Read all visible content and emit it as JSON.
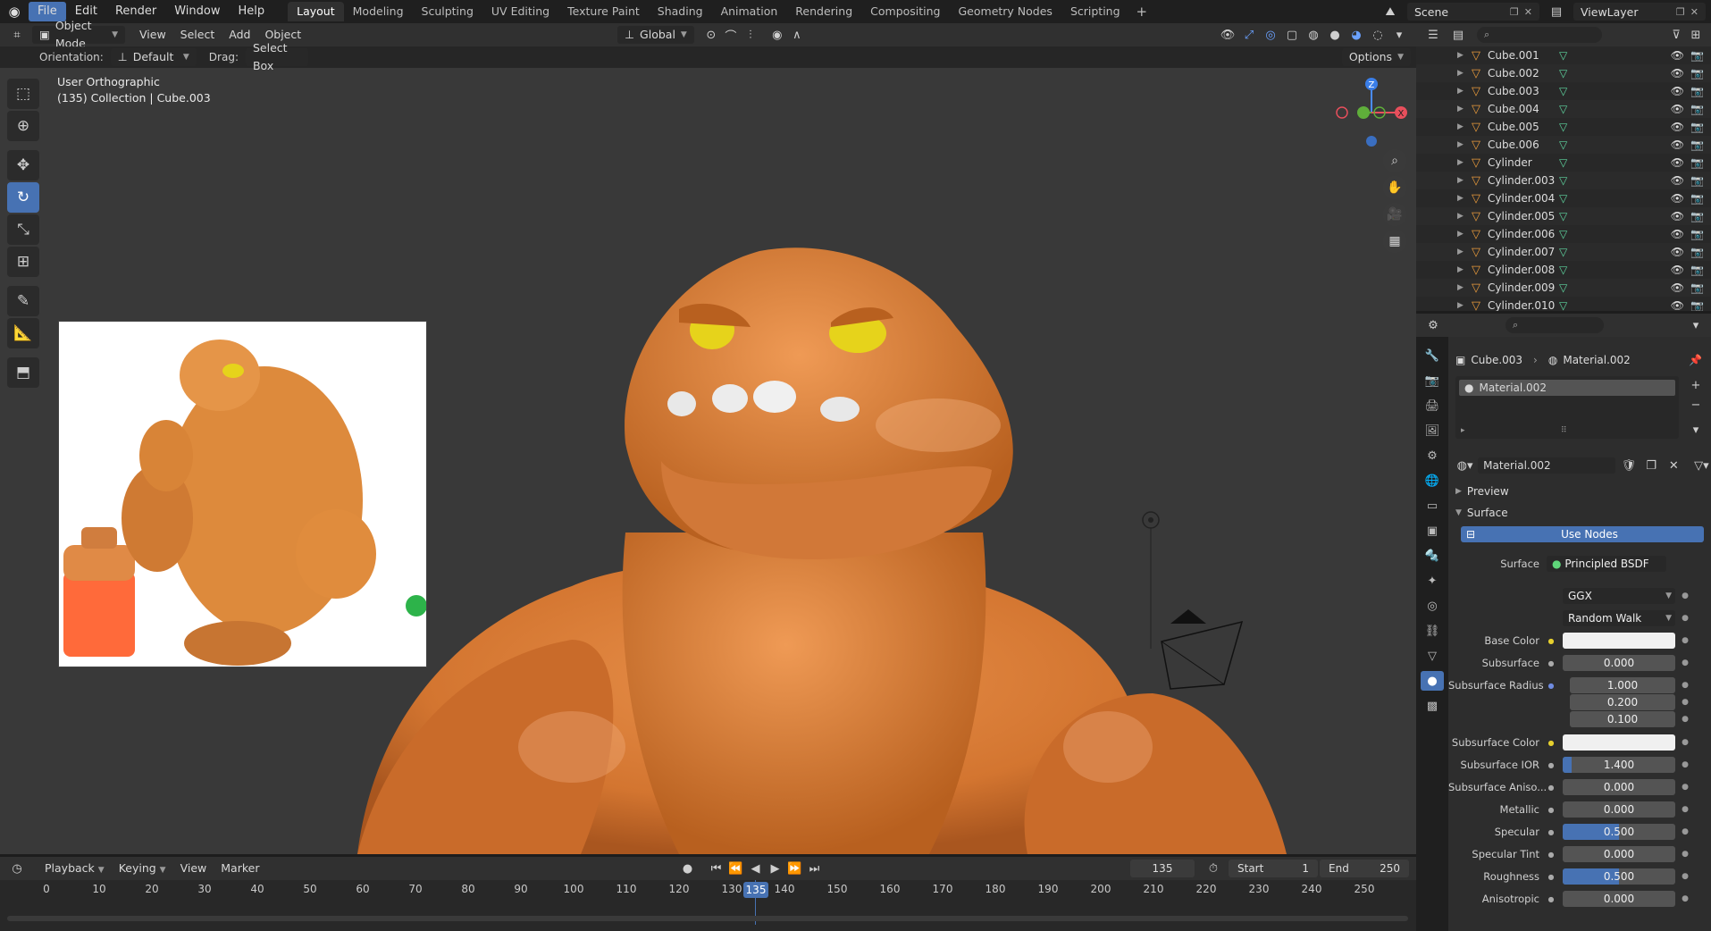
{
  "menubar": {
    "items": [
      "File",
      "Edit",
      "Render",
      "Window",
      "Help"
    ],
    "workspaces": [
      "Layout",
      "Modeling",
      "Sculpting",
      "UV Editing",
      "Texture Paint",
      "Shading",
      "Animation",
      "Rendering",
      "Compositing",
      "Geometry Nodes",
      "Scripting"
    ],
    "scene": "Scene",
    "view_layer": "ViewLayer"
  },
  "viewport_header": {
    "mode": "Object Mode",
    "menus": [
      "View",
      "Select",
      "Add",
      "Object"
    ],
    "transform_orientation": "Global",
    "orientation_label": "Orientation:",
    "orientation_value": "Default",
    "drag_label": "Drag:",
    "drag_value": "Select Box",
    "options": "Options"
  },
  "viewport": {
    "view_name": "User Orthographic",
    "collection_info": "(135) Collection | Cube.003"
  },
  "timeline": {
    "menus": [
      "Playback",
      "Keying",
      "View",
      "Marker"
    ],
    "current_frame": "135",
    "start_label": "Start",
    "start": "1",
    "end_label": "End",
    "end": "250",
    "ticks": [
      "0",
      "10",
      "20",
      "30",
      "40",
      "50",
      "60",
      "70",
      "80",
      "90",
      "100",
      "110",
      "120",
      "130",
      "140",
      "150",
      "160",
      "170",
      "180",
      "190",
      "200",
      "210",
      "220",
      "230",
      "240",
      "250"
    ]
  },
  "outliner": {
    "items": [
      "Cube.001",
      "Cube.002",
      "Cube.003",
      "Cube.004",
      "Cube.005",
      "Cube.006",
      "Cylinder",
      "Cylinder.003",
      "Cylinder.004",
      "Cylinder.005",
      "Cylinder.006",
      "Cylinder.007",
      "Cylinder.008",
      "Cylinder.009",
      "Cylinder.010"
    ]
  },
  "properties": {
    "breadcrumb_object": "Cube.003",
    "breadcrumb_material": "Material.002",
    "slot": "Material.002",
    "material_name": "Material.002",
    "preview_label": "Preview",
    "surface_section": "Surface",
    "use_nodes": "Use Nodes",
    "surface_label": "Surface",
    "surface_value": "Principled BSDF",
    "distribution": "GGX",
    "subsurface_method": "Random Walk",
    "fields": {
      "base_color": "Base Color",
      "subsurface": "Subsurface",
      "subsurface_v": "0.000",
      "subsurface_radius": "Subsurface Radius",
      "sr1": "1.000",
      "sr2": "0.200",
      "sr3": "0.100",
      "subsurface_color": "Subsurface Color",
      "subsurface_ior": "Subsurface IOR",
      "subsurface_ior_v": "1.400",
      "subsurface_aniso": "Subsurface Aniso...",
      "subsurface_aniso_v": "0.000",
      "metallic": "Metallic",
      "metallic_v": "0.000",
      "specular": "Specular",
      "specular_v": "0.500",
      "specular_tint": "Specular Tint",
      "specular_tint_v": "0.000",
      "roughness": "Roughness",
      "roughness_v": "0.500",
      "anisotropic": "Anisotropic",
      "anisotropic_v": "0.000"
    },
    "levels": {
      "subsurface_ior": 0.08,
      "specular": 0.5,
      "roughness": 0.5
    }
  },
  "colors": {
    "accent": "#4772b3",
    "figure": "#d87c35",
    "outliner_object": "#e89a3c",
    "mesh": "#5fd6a0"
  }
}
